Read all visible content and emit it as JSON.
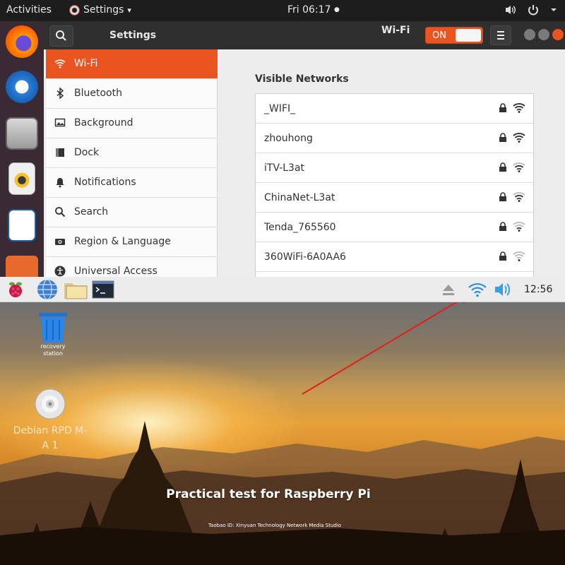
{
  "top_bar": {
    "activities": "Activities",
    "app_menu": "Settings",
    "app_menu_arrow": "▾",
    "clock": "Fri 06:17",
    "clock_dot": "●",
    "tray_icons": [
      "speaker-icon",
      "power-icon",
      "chevron-down-icon"
    ]
  },
  "dock": {
    "items": [
      "firefox-icon",
      "thunderbird-icon",
      "files-icon",
      "rhythmbox-icon",
      "libreoffice-writer-icon",
      "software-center-icon"
    ]
  },
  "settings": {
    "sidebar_title": "Settings",
    "panel_title": "Wi-Fi",
    "toggle_label": "ON",
    "toggle_state": "on",
    "sidebar": [
      {
        "label": "Wi-Fi",
        "icon": "wifi-icon",
        "active": true
      },
      {
        "label": "Bluetooth",
        "icon": "bluetooth-icon",
        "active": false
      },
      {
        "label": "Background",
        "icon": "background-icon",
        "active": false
      },
      {
        "label": "Dock",
        "icon": "dock-icon",
        "active": false
      },
      {
        "label": "Notifications",
        "icon": "bell-icon",
        "active": false
      },
      {
        "label": "Search",
        "icon": "search-icon",
        "active": false
      },
      {
        "label": "Region & Language",
        "icon": "camera-icon",
        "active": false
      },
      {
        "label": "Universal Access",
        "icon": "accessibility-icon",
        "active": false
      }
    ],
    "visible_networks_heading": "Visible Networks",
    "networks": [
      {
        "name": "_WIFI_",
        "secured": true,
        "signal": 4
      },
      {
        "name": "zhouhong",
        "secured": true,
        "signal": 4
      },
      {
        "name": "iTV-L3at",
        "secured": true,
        "signal": 3
      },
      {
        "name": "ChinaNet-L3at",
        "secured": true,
        "signal": 3
      },
      {
        "name": "Tenda_765560",
        "secured": true,
        "signal": 2
      },
      {
        "name": "360WiFi-6A0AA6",
        "secured": true,
        "signal": 1
      }
    ],
    "accent_color": "#e95420"
  },
  "pi_panel": {
    "launchers": [
      "raspberry-menu-icon",
      "web-browser-icon",
      "file-manager-icon",
      "terminal-icon"
    ],
    "tray": [
      "eject-icon",
      "wifi-icon",
      "volume-icon"
    ],
    "clock": "12:56"
  },
  "desktop": {
    "icons": [
      {
        "label": "recovery\nstation",
        "icon": "trash-bin-icon"
      },
      {
        "label": "Debian RPD M-\nA 1",
        "icon": "cd-disc-icon"
      }
    ],
    "title": "Practical test for Raspberry Pi",
    "credit": "Taobao ID: Xinyuan Technology Network Media Studio",
    "arrow_color": "#e0201a"
  }
}
